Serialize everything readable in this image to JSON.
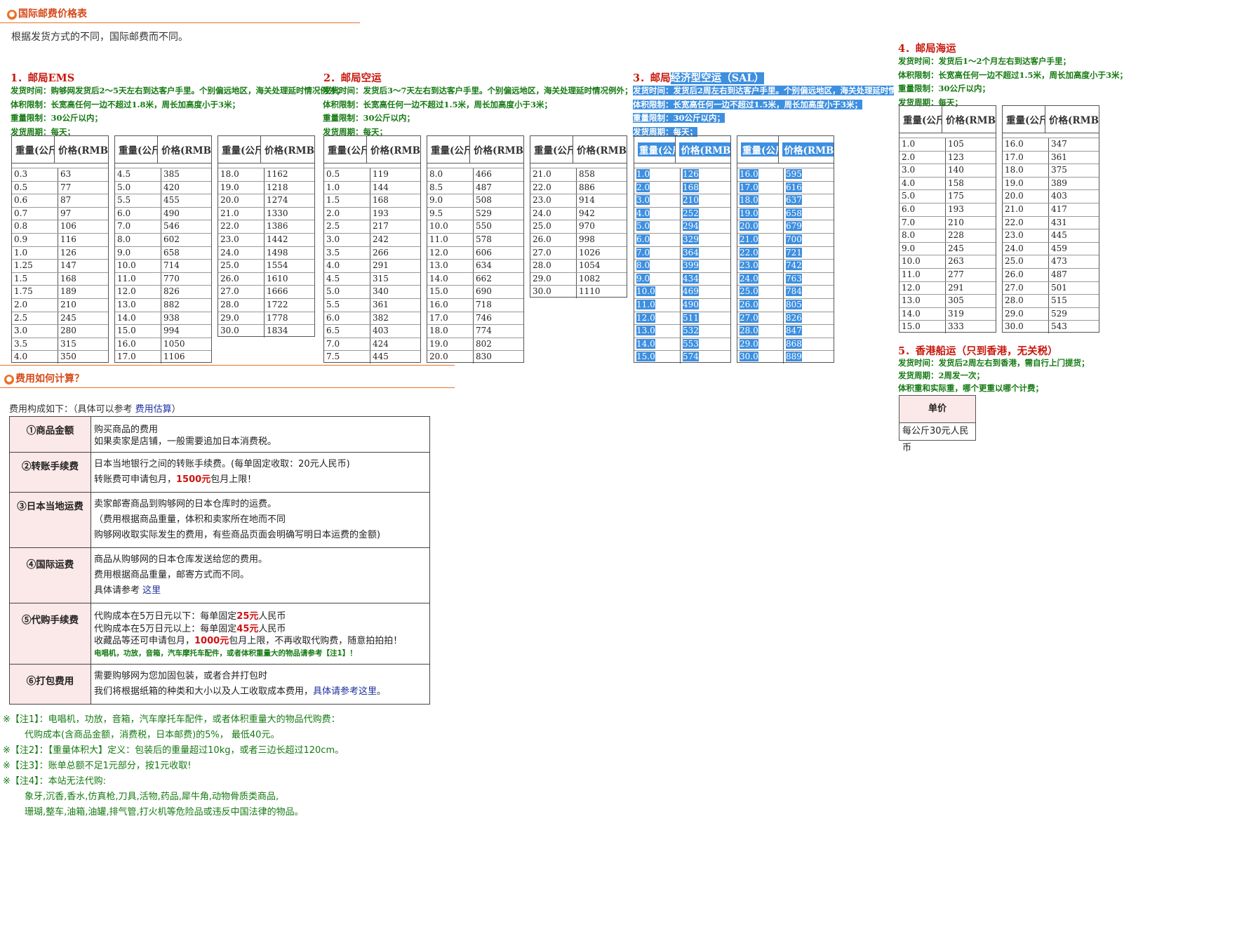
{
  "section1": {
    "title": "国际邮费价格表",
    "intro": "根据发货方式的不同，国际邮费而不同。"
  },
  "ems": {
    "title": "1．邮局EMS",
    "info": [
      "发货时间：购够网发货后2～5天左右到达客户手里。个别偏远地区，海关处理延时情况例外；",
      "体积限制：长宽高任何一边不超过1.8米，周长加高度小于3米；",
      "重量限制：30公斤以内；",
      "发货周期：每天；"
    ],
    "columns": [
      [
        [
          "0.3",
          "63"
        ],
        [
          "0.5",
          "77"
        ],
        [
          "0.6",
          "87"
        ],
        [
          "0.7",
          "97"
        ],
        [
          "0.8",
          "106"
        ],
        [
          "0.9",
          "116"
        ],
        [
          "1.0",
          "126"
        ],
        [
          "1.25",
          "147"
        ],
        [
          "1.5",
          "168"
        ],
        [
          "1.75",
          "189"
        ],
        [
          "2.0",
          "210"
        ],
        [
          "2.5",
          "245"
        ],
        [
          "3.0",
          "280"
        ],
        [
          "3.5",
          "315"
        ],
        [
          "4.0",
          "350"
        ]
      ],
      [
        [
          "4.5",
          "385"
        ],
        [
          "5.0",
          "420"
        ],
        [
          "5.5",
          "455"
        ],
        [
          "6.0",
          "490"
        ],
        [
          "7.0",
          "546"
        ],
        [
          "8.0",
          "602"
        ],
        [
          "9.0",
          "658"
        ],
        [
          "10.0",
          "714"
        ],
        [
          "11.0",
          "770"
        ],
        [
          "12.0",
          "826"
        ],
        [
          "13.0",
          "882"
        ],
        [
          "14.0",
          "938"
        ],
        [
          "15.0",
          "994"
        ],
        [
          "16.0",
          "1050"
        ],
        [
          "17.0",
          "1106"
        ]
      ],
      [
        [
          "18.0",
          "1162"
        ],
        [
          "19.0",
          "1218"
        ],
        [
          "20.0",
          "1274"
        ],
        [
          "21.0",
          "1330"
        ],
        [
          "22.0",
          "1386"
        ],
        [
          "23.0",
          "1442"
        ],
        [
          "24.0",
          "1498"
        ],
        [
          "25.0",
          "1554"
        ],
        [
          "26.0",
          "1610"
        ],
        [
          "27.0",
          "1666"
        ],
        [
          "28.0",
          "1722"
        ],
        [
          "29.0",
          "1778"
        ],
        [
          "30.0",
          "1834"
        ]
      ]
    ]
  },
  "air": {
    "title": "2．邮局空运",
    "info": [
      "发货时间：发货后3～7天左右到达客户手里。个别偏远地区，海关处理延时情况例外；",
      "体积限制：长宽高任何一边不超过1.5米，周长加高度小于3米；",
      "重量限制：30公斤以内；",
      "发货周期：每天；"
    ],
    "columns": [
      [
        [
          "0.5",
          "119"
        ],
        [
          "1.0",
          "144"
        ],
        [
          "1.5",
          "168"
        ],
        [
          "2.0",
          "193"
        ],
        [
          "2.5",
          "217"
        ],
        [
          "3.0",
          "242"
        ],
        [
          "3.5",
          "266"
        ],
        [
          "4.0",
          "291"
        ],
        [
          "4.5",
          "315"
        ],
        [
          "5.0",
          "340"
        ],
        [
          "5.5",
          "361"
        ],
        [
          "6.0",
          "382"
        ],
        [
          "6.5",
          "403"
        ],
        [
          "7.0",
          "424"
        ],
        [
          "7.5",
          "445"
        ]
      ],
      [
        [
          "8.0",
          "466"
        ],
        [
          "8.5",
          "487"
        ],
        [
          "9.0",
          "508"
        ],
        [
          "9.5",
          "529"
        ],
        [
          "10.0",
          "550"
        ],
        [
          "11.0",
          "578"
        ],
        [
          "12.0",
          "606"
        ],
        [
          "13.0",
          "634"
        ],
        [
          "14.0",
          "662"
        ],
        [
          "15.0",
          "690"
        ],
        [
          "16.0",
          "718"
        ],
        [
          "17.0",
          "746"
        ],
        [
          "18.0",
          "774"
        ],
        [
          "19.0",
          "802"
        ],
        [
          "20.0",
          "830"
        ]
      ],
      [
        [
          "21.0",
          "858"
        ],
        [
          "22.0",
          "886"
        ],
        [
          "23.0",
          "914"
        ],
        [
          "24.0",
          "942"
        ],
        [
          "25.0",
          "970"
        ],
        [
          "26.0",
          "998"
        ],
        [
          "27.0",
          "1026"
        ],
        [
          "28.0",
          "1054"
        ],
        [
          "29.0",
          "1082"
        ],
        [
          "30.0",
          "1110"
        ]
      ]
    ]
  },
  "sal": {
    "title_a": "3．邮局",
    "title_b": "经济型空运（SAL）",
    "info": [
      "发货时间：发货后2周左右到达客户手里。个别偏远地区，海关处理延时情况例",
      "体积限制：长宽高任何一边不超过1.5米，周长加高度小于3米；",
      "重量限制：30公斤以内；",
      "发货周期：每天；"
    ],
    "columns": [
      [
        [
          "1.0",
          "126"
        ],
        [
          "2.0",
          "168"
        ],
        [
          "3.0",
          "210"
        ],
        [
          "4.0",
          "252"
        ],
        [
          "5.0",
          "294"
        ],
        [
          "6.0",
          "329"
        ],
        [
          "7.0",
          "364"
        ],
        [
          "8.0",
          "399"
        ],
        [
          "9.0",
          "434"
        ],
        [
          "10.0",
          "469"
        ],
        [
          "11.0",
          "490"
        ],
        [
          "12.0",
          "511"
        ],
        [
          "13.0",
          "532"
        ],
        [
          "14.0",
          "553"
        ],
        [
          "15.0",
          "574"
        ]
      ],
      [
        [
          "16.0",
          "595"
        ],
        [
          "17.0",
          "616"
        ],
        [
          "18.0",
          "637"
        ],
        [
          "19.0",
          "658"
        ],
        [
          "20.0",
          "679"
        ],
        [
          "21.0",
          "700"
        ],
        [
          "22.0",
          "721"
        ],
        [
          "23.0",
          "742"
        ],
        [
          "24.0",
          "763"
        ],
        [
          "25.0",
          "784"
        ],
        [
          "26.0",
          "805"
        ],
        [
          "27.0",
          "826"
        ],
        [
          "28.0",
          "847"
        ],
        [
          "29.0",
          "868"
        ],
        [
          "30.0",
          "889"
        ]
      ]
    ]
  },
  "sea": {
    "title": "4．邮局海运",
    "info": [
      "发货时间：发货后1～2个月左右到达客户手里；",
      "体积限制：长宽高任何一边不超过1.5米，周长加高度小于3米；",
      "重量限制：30公斤以内；",
      "发货周期：每天；"
    ],
    "columns": [
      [
        [
          "1.0",
          "105"
        ],
        [
          "2.0",
          "123"
        ],
        [
          "3.0",
          "140"
        ],
        [
          "4.0",
          "158"
        ],
        [
          "5.0",
          "175"
        ],
        [
          "6.0",
          "193"
        ],
        [
          "7.0",
          "210"
        ],
        [
          "8.0",
          "228"
        ],
        [
          "9.0",
          "245"
        ],
        [
          "10.0",
          "263"
        ],
        [
          "11.0",
          "277"
        ],
        [
          "12.0",
          "291"
        ],
        [
          "13.0",
          "305"
        ],
        [
          "14.0",
          "319"
        ],
        [
          "15.0",
          "333"
        ]
      ],
      [
        [
          "16.0",
          "347"
        ],
        [
          "17.0",
          "361"
        ],
        [
          "18.0",
          "375"
        ],
        [
          "19.0",
          "389"
        ],
        [
          "20.0",
          "403"
        ],
        [
          "21.0",
          "417"
        ],
        [
          "22.0",
          "431"
        ],
        [
          "23.0",
          "445"
        ],
        [
          "24.0",
          "459"
        ],
        [
          "25.0",
          "473"
        ],
        [
          "26.0",
          "487"
        ],
        [
          "27.0",
          "501"
        ],
        [
          "28.0",
          "515"
        ],
        [
          "29.0",
          "529"
        ],
        [
          "30.0",
          "543"
        ]
      ]
    ]
  },
  "hk": {
    "title": "5．香港船运（只到香港，无关税）",
    "info": [
      "发货时间：发货后2周左右到香港，需自行上门提货；",
      "发货周期：2周发一次；",
      "体积重和实际重，哪个更重以哪个计费；"
    ],
    "unit_header": "单价",
    "unit_value": "每公斤30元人民币"
  },
  "headers": {
    "weight": "重量(公斤)",
    "price": "价格(RMB)"
  },
  "section2": {
    "title": "费用如何计算？",
    "intro_prefix": "费用构成如下：（具体可以参考",
    "intro_link": "费用估算",
    "intro_suffix": "）"
  },
  "fees": {
    "r1": {
      "label": "①商品金额",
      "l1": "购买商品的费用",
      "l2": "如果卖家是店铺，一般需要追加日本消费税。"
    },
    "r2": {
      "label": "②转账手续费",
      "l1": "日本当地银行之间的转账手续费。(每单固定收取：20元人民币)",
      "l2a": "转账费可申请包月，",
      "l2b": "1500元",
      "l2c": "包月上限！"
    },
    "r3": {
      "label": "③日本当地运费",
      "l1": "卖家邮寄商品到购够网的日本仓库时的运费。",
      "l2": "（费用根据商品重量，体积和卖家所在地而不同",
      "l3": "购够网收取实际发生的费用，有些商品页面会明确写明日本运费的金额)"
    },
    "r4": {
      "label": "④国际运费",
      "l1": "商品从购够网的日本仓库发送给您的费用。",
      "l2": "费用根据商品重量，邮寄方式而不同。",
      "l3a": "具体请参考",
      "l3b": "这里"
    },
    "r5": {
      "label": "⑤代购手续费",
      "l1a": "代购成本在5万日元以下：每单固定",
      "l1b": "25元",
      "l1c": "人民币",
      "l2a": "代购成本在5万日元以上：每单固定",
      "l2b": "45元",
      "l2c": "人民币",
      "l3a": "收藏品等还可申请包月，",
      "l3b": "1000元",
      "l3c": "包月上限，不再收取代购费，随意拍拍拍！",
      "l4": "电唱机，功放，音箱，汽车摩托车配件，或者体积重量大的物品请参考【注1】！"
    },
    "r6": {
      "label": "⑥打包费用",
      "l1": "需要购够网为您加固包装，或者合并打包时",
      "l2a": "我们将根据纸箱的种类和大小以及人工收取成本费用，",
      "l2b": "具体请参考这里",
      "l2c": "。"
    }
  },
  "notes": {
    "n1": "※【注1】：电唱机，功放，音箱，汽车摩托车配件，或者体积重量大的物品代购费：",
    "n1b": "代购成本(含商品金额，消费税，日本邮费)的5%， 最低40元。",
    "n2": "※【注2】：【重量体积大】定义：包装后的重量超过10kg，或者三边长超过120cm。",
    "n3": "※【注3】：账单总额不足1元部分，按1元收取!",
    "n4": "※【注4】：本站无法代购:",
    "n4a": "象牙,沉香,香水,仿真枪,刀具,活物,药品,犀牛角,动物骨质类商品,",
    "n4b": "珊瑚,整车,油箱,油罐,排气管,打火机等危险品或违反中国法律的物品。"
  }
}
